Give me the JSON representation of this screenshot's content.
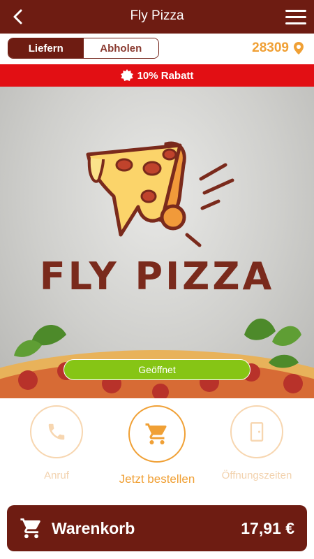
{
  "header": {
    "title": "Fly Pizza"
  },
  "delivery": {
    "options": [
      "Liefern",
      "Abholen"
    ],
    "selected": "Liefern",
    "zip": "28309"
  },
  "banner": {
    "discount_text": "10% Rabatt"
  },
  "hero": {
    "brand_text": "FLY PIZZA",
    "status": "Geöffnet"
  },
  "actions": [
    {
      "label": "Anruf",
      "icon": "phone-icon",
      "state": "disabled"
    },
    {
      "label": "Jetzt bestellen",
      "icon": "cart-icon",
      "state": "active"
    },
    {
      "label": "Öffnungszeiten",
      "icon": "door-icon",
      "state": "disabled"
    }
  ],
  "cart": {
    "label": "Warenkorb",
    "total": "17,91 €"
  },
  "colors": {
    "primary": "#6e1c12",
    "accent": "#f0a035",
    "discount": "#e20f14",
    "open": "#86c515"
  }
}
